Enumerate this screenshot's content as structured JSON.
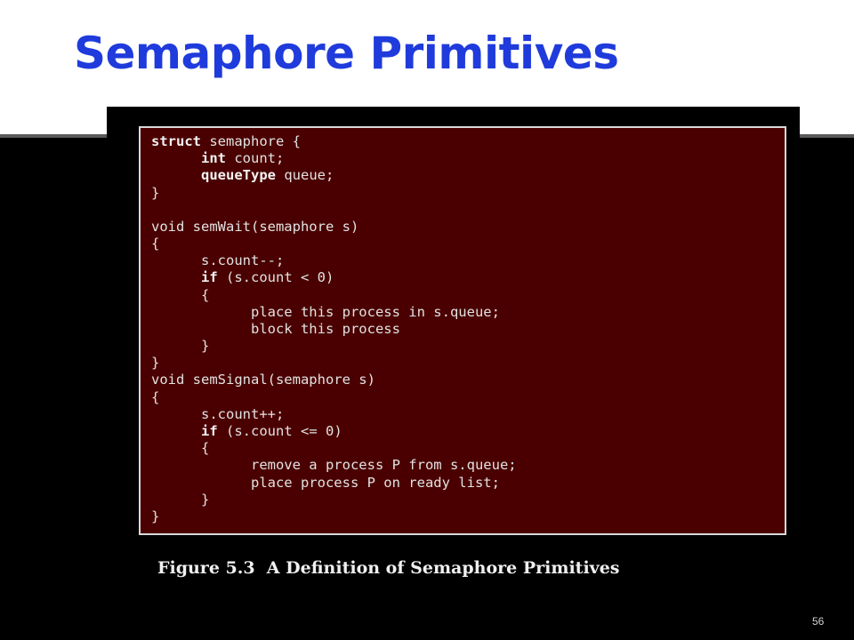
{
  "slide": {
    "title": "Semaphore Primitives",
    "page_number": "56"
  },
  "figure": {
    "caption": "Figure 5.3  A Definition of Semaphore Primitives",
    "code": {
      "l1_kw": "struct",
      "l1_rest": " semaphore {",
      "l2_kw": "int",
      "l2_rest": " count;",
      "l3_kw": "queueType",
      "l3_rest": " queue;",
      "l4": "}",
      "l5": "void semWait(semaphore s)",
      "l6": "{",
      "l7": "s.count--;",
      "l8_kw": "if",
      "l8_rest": " (s.count < 0)",
      "l9": "{",
      "l10": "place this process in s.queue;",
      "l11": "block this process",
      "l12": "}",
      "l13": "}",
      "l14": "void semSignal(semaphore s)",
      "l15": "{",
      "l16": "s.count++;",
      "l17_kw": "if",
      "l17_rest": " (s.count <= 0)",
      "l18": "{",
      "l19": "remove a process P from s.queue;",
      "l20": "place process P on ready list;",
      "l21": "}",
      "l22": "}"
    }
  },
  "colors": {
    "title": "#1f3bdc",
    "code_background": "#4a0000",
    "code_text": "#e2e2e2",
    "slide_background": "#000000"
  }
}
